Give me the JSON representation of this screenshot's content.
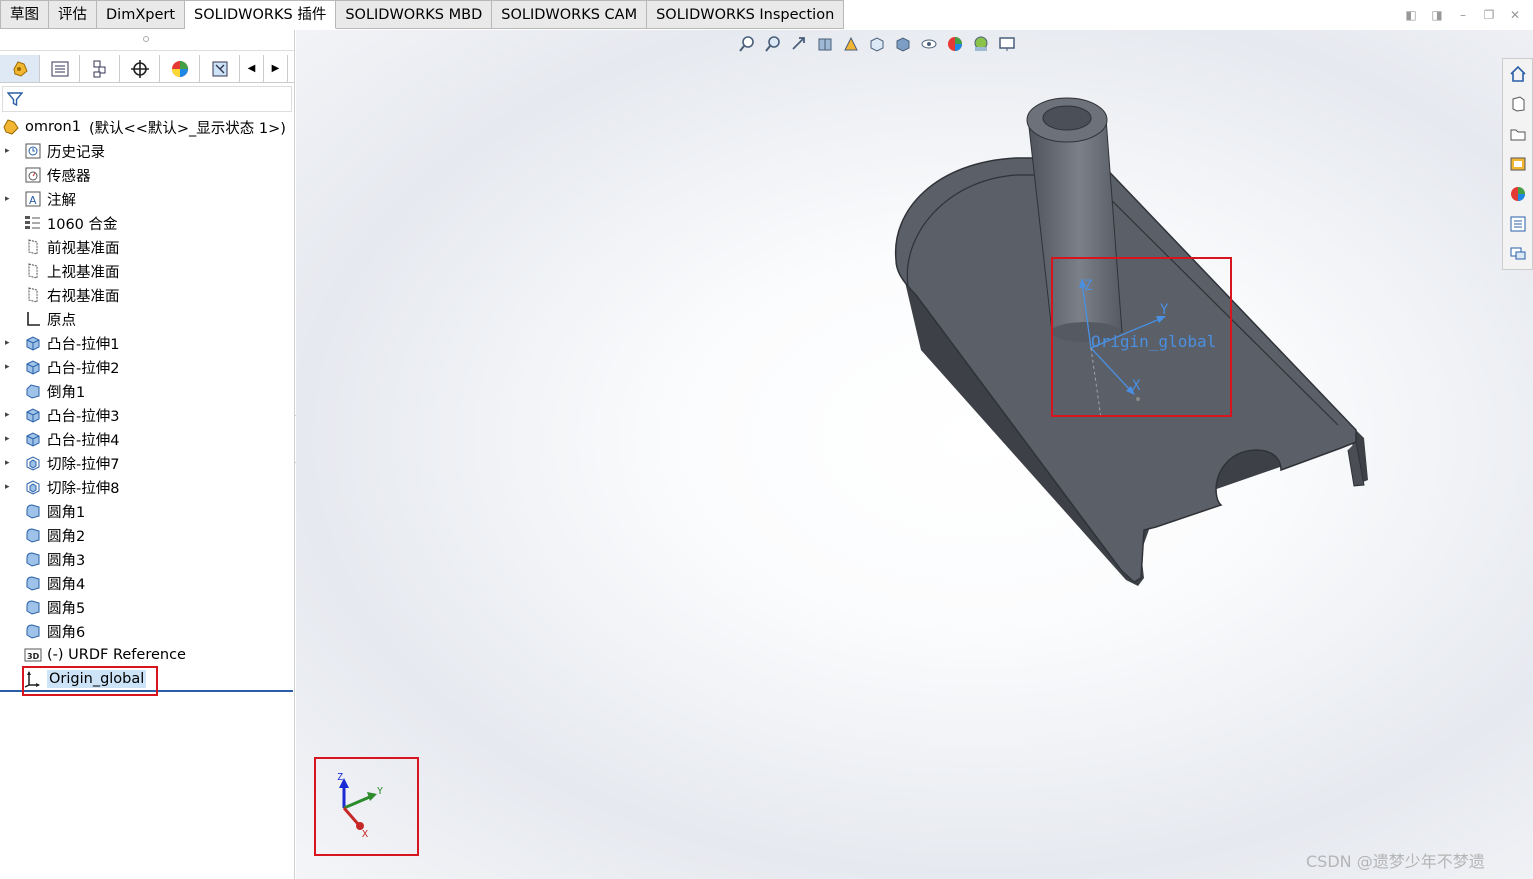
{
  "tabs": [
    "草图",
    "评估",
    "DimXpert",
    "SOLIDWORKS 插件",
    "SOLIDWORKS MBD",
    "SOLIDWORKS CAM",
    "SOLIDWORKS Inspection"
  ],
  "active_tab": "SOLIDWORKS 插件",
  "feature_tree": {
    "root_name": "omron1",
    "root_config": "(默认<<默认>_显示状态 1>)",
    "items": [
      {
        "label": "历史记录",
        "icon": "history-icon",
        "expandable": true
      },
      {
        "label": "传感器",
        "icon": "sensor-icon",
        "expandable": false
      },
      {
        "label": "注解",
        "icon": "annotation-icon",
        "expandable": true
      },
      {
        "label": "1060 合金",
        "icon": "material-icon",
        "expandable": false
      },
      {
        "label": "前视基准面",
        "icon": "plane-icon",
        "expandable": false
      },
      {
        "label": "上视基准面",
        "icon": "plane-icon",
        "expandable": false
      },
      {
        "label": "右视基准面",
        "icon": "plane-icon",
        "expandable": false
      },
      {
        "label": "原点",
        "icon": "origin-icon",
        "expandable": false
      },
      {
        "label": "凸台-拉伸1",
        "icon": "boss-extrude-icon",
        "expandable": true
      },
      {
        "label": "凸台-拉伸2",
        "icon": "boss-extrude-icon",
        "expandable": true
      },
      {
        "label": "倒角1",
        "icon": "chamfer-icon",
        "expandable": false
      },
      {
        "label": "凸台-拉伸3",
        "icon": "boss-extrude-icon",
        "expandable": true
      },
      {
        "label": "凸台-拉伸4",
        "icon": "boss-extrude-icon",
        "expandable": true
      },
      {
        "label": "切除-拉伸7",
        "icon": "cut-extrude-icon",
        "expandable": true
      },
      {
        "label": "切除-拉伸8",
        "icon": "cut-extrude-icon",
        "expandable": true
      },
      {
        "label": "圆角1",
        "icon": "fillet-icon",
        "expandable": false
      },
      {
        "label": "圆角2",
        "icon": "fillet-icon",
        "expandable": false
      },
      {
        "label": "圆角3",
        "icon": "fillet-icon",
        "expandable": false
      },
      {
        "label": "圆角4",
        "icon": "fillet-icon",
        "expandable": false
      },
      {
        "label": "圆角5",
        "icon": "fillet-icon",
        "expandable": false
      },
      {
        "label": "圆角6",
        "icon": "fillet-icon",
        "expandable": false
      },
      {
        "label": "(-) URDF Reference",
        "icon": "3d-sketch-icon",
        "expandable": false
      },
      {
        "label": "Origin_global",
        "icon": "coordinate-system-icon",
        "expandable": false,
        "selected": true
      }
    ]
  },
  "viewport": {
    "coordinate_label": "Origin_global",
    "axis_labels": {
      "x": "X",
      "y": "Y",
      "z": "Z"
    },
    "triad_labels": {
      "x": "X",
      "y": "Y",
      "z": "Z"
    }
  },
  "watermark": "CSDN @遗梦少年不梦遗",
  "colors": {
    "part": "#5b5f68",
    "highlight_box": "#d8141e",
    "axis_blue": "#4a90e2",
    "selection": "#cde3f7"
  }
}
